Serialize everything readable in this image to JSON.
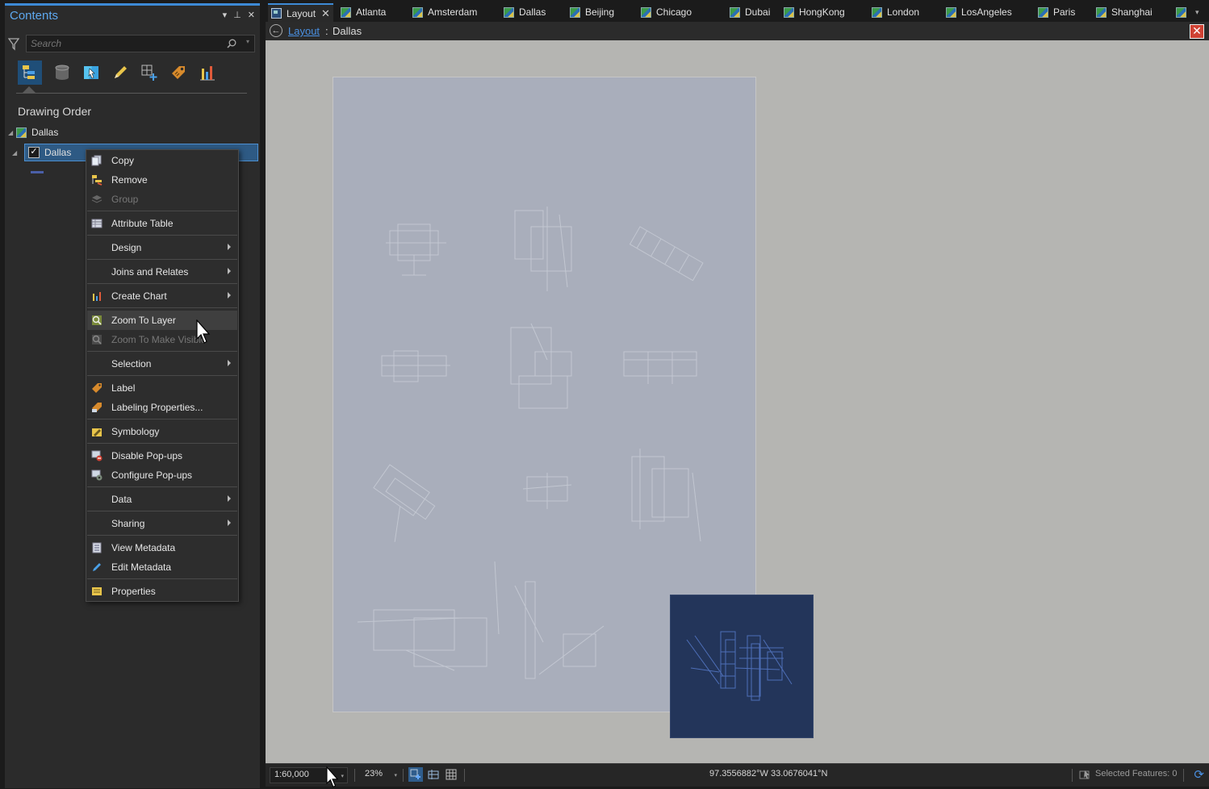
{
  "contents": {
    "title": "Contents",
    "search_placeholder": "Search",
    "section_title": "Drawing Order",
    "map_name": "Dallas",
    "layer_name": "Dallas",
    "layer_checked": true,
    "tools": [
      "list-by-drawing-order-icon",
      "list-by-source-icon",
      "list-by-selection-icon",
      "list-by-editing-icon",
      "list-by-snapping-icon",
      "list-by-labeling-icon",
      "list-by-charts-icon"
    ]
  },
  "context_menu": {
    "items": [
      {
        "label": "Copy",
        "icon": "copy-icon",
        "enabled": true
      },
      {
        "label": "Remove",
        "icon": "remove-icon",
        "enabled": true
      },
      {
        "label": "Group",
        "icon": "group-icon",
        "enabled": false
      },
      {
        "label": "Attribute Table",
        "icon": "attribute-table-icon",
        "enabled": true
      },
      {
        "label": "Design",
        "submenu": true,
        "enabled": true
      },
      {
        "label": "Joins and Relates",
        "submenu": true,
        "enabled": true
      },
      {
        "label": "Create Chart",
        "icon": "chart-icon",
        "submenu": true,
        "enabled": true
      },
      {
        "label": "Zoom To Layer",
        "icon": "zoom-to-layer-icon",
        "enabled": true,
        "hovered": true
      },
      {
        "label": "Zoom To Make Visible",
        "icon": "zoom-to-visible-icon",
        "enabled": false
      },
      {
        "label": "Selection",
        "submenu": true,
        "enabled": true
      },
      {
        "label": "Label",
        "icon": "label-icon",
        "enabled": true
      },
      {
        "label": "Labeling Properties...",
        "icon": "labeling-properties-icon",
        "enabled": true
      },
      {
        "label": "Symbology",
        "icon": "symbology-icon",
        "enabled": true
      },
      {
        "label": "Disable Pop-ups",
        "icon": "disable-popups-icon",
        "enabled": true
      },
      {
        "label": "Configure Pop-ups",
        "icon": "configure-popups-icon",
        "enabled": true
      },
      {
        "label": "Data",
        "submenu": true,
        "enabled": true
      },
      {
        "label": "Sharing",
        "submenu": true,
        "enabled": true
      },
      {
        "label": "View Metadata",
        "icon": "view-metadata-icon",
        "enabled": true
      },
      {
        "label": "Edit Metadata",
        "icon": "edit-metadata-icon",
        "enabled": true
      },
      {
        "label": "Properties",
        "icon": "properties-icon",
        "enabled": true
      }
    ]
  },
  "tabs": [
    "Layout",
    "Atlanta",
    "Amsterdam",
    "Dallas",
    "Beijing",
    "Chicago",
    "Dubai",
    "HongKong",
    "London",
    "LosAngeles",
    "Paris",
    "Shanghai"
  ],
  "active_tab": "Layout",
  "view": {
    "breadcrumb_link": "Layout",
    "breadcrumb_sep": ":",
    "breadcrumb_current": "Dallas"
  },
  "statusbar": {
    "scale": "1:60,000",
    "zoom": "23%",
    "coordinates": "97.3556882°W 33.0676041°N",
    "selected_features": "Selected Features: 0"
  },
  "colors": {
    "accent": "#3d8ad6",
    "link": "#4a90e2",
    "page": "#a9aebb",
    "inset_map": "#23355a",
    "close_button": "#d04234"
  }
}
